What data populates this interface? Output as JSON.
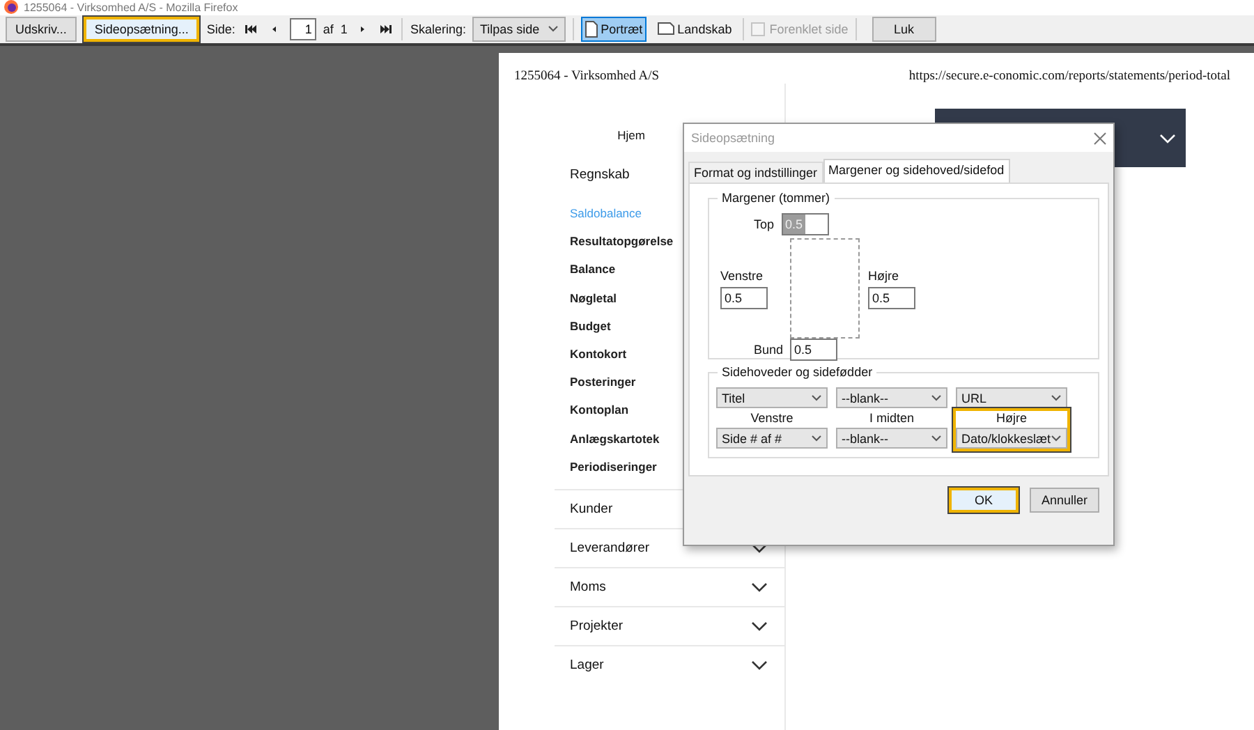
{
  "window": {
    "title": "1255064 - Virksomhed A/S - Mozilla Firefox"
  },
  "toolbar": {
    "print_button": {
      "label": "Udskriv...",
      "highlighted": false
    },
    "page_setup_button": {
      "label": "Sideopsætning...",
      "highlighted": true
    },
    "page_label": "Side:",
    "page_value": "1",
    "of_label": "af",
    "page_total": "1",
    "scale_label": "Skalering:",
    "scale_select": "Tilpas side",
    "orientation": [
      {
        "label": "Portræt",
        "selected": true
      },
      {
        "label": "Landskab",
        "selected": false
      }
    ],
    "simplify": {
      "label": "Forenklet side",
      "checked": false,
      "disabled": true
    },
    "close_button": "Luk"
  },
  "page": {
    "header_left": "1255064 - Virksomhed A/S",
    "header_right": "https://secure.e-conomic.com/reports/statements/period-total",
    "nav": [
      {
        "label": "Hjem",
        "kind": "home"
      },
      {
        "label": "Regnskab",
        "kind": "section",
        "expanded": true,
        "children": [
          {
            "label": "Saldobalance",
            "selected": true
          },
          {
            "label": "Resultatopgørelse",
            "selected": false
          },
          {
            "label": "Balance",
            "selected": false
          },
          {
            "label": "Nøgletal",
            "selected": false
          },
          {
            "label": "Budget",
            "selected": false
          },
          {
            "label": "Kontokort",
            "selected": false
          },
          {
            "label": "Posteringer",
            "selected": false
          },
          {
            "label": "Kontoplan",
            "selected": false
          },
          {
            "label": "Anlægskartotek",
            "selected": false
          },
          {
            "label": "Periodiseringer",
            "selected": false
          }
        ]
      },
      {
        "label": "Kunder",
        "kind": "section",
        "expanded": false
      },
      {
        "label": "Leverandører",
        "kind": "section",
        "expanded": false
      },
      {
        "label": "Moms",
        "kind": "section",
        "expanded": false
      },
      {
        "label": "Projekter",
        "kind": "section",
        "expanded": false
      },
      {
        "label": "Lager",
        "kind": "section",
        "expanded": false
      }
    ]
  },
  "dialog": {
    "title": "Sideopsætning",
    "tabs": [
      {
        "label": "Format og indstillinger",
        "selected": false
      },
      {
        "label": "Margener og sidehoved/sidefod",
        "selected": true
      }
    ],
    "margins": {
      "legend": "Margener (tommer)",
      "top": {
        "label": "Top",
        "value": "0.5",
        "text_selected": true
      },
      "left": {
        "label": "Venstre",
        "value": "0.5",
        "text_selected": false
      },
      "right": {
        "label": "Højre",
        "value": "0.5",
        "text_selected": false
      },
      "bottom": {
        "label": "Bund",
        "value": "0.5",
        "text_selected": false
      }
    },
    "headers_footers": {
      "legend": "Sidehoveder og sidefødder",
      "columns": [
        {
          "header": "Titel",
          "label": "Venstre",
          "footer": "Side # af #",
          "highlighted": false
        },
        {
          "header": "--blank--",
          "label": "I midten",
          "footer": "--blank--",
          "highlighted": false
        },
        {
          "header": "URL",
          "label": "Højre",
          "footer": "Dato/klokkeslæt",
          "highlighted": true
        }
      ]
    },
    "buttons": [
      {
        "label": "OK",
        "highlighted": true
      },
      {
        "label": "Annuller",
        "highlighted": false
      }
    ]
  }
}
